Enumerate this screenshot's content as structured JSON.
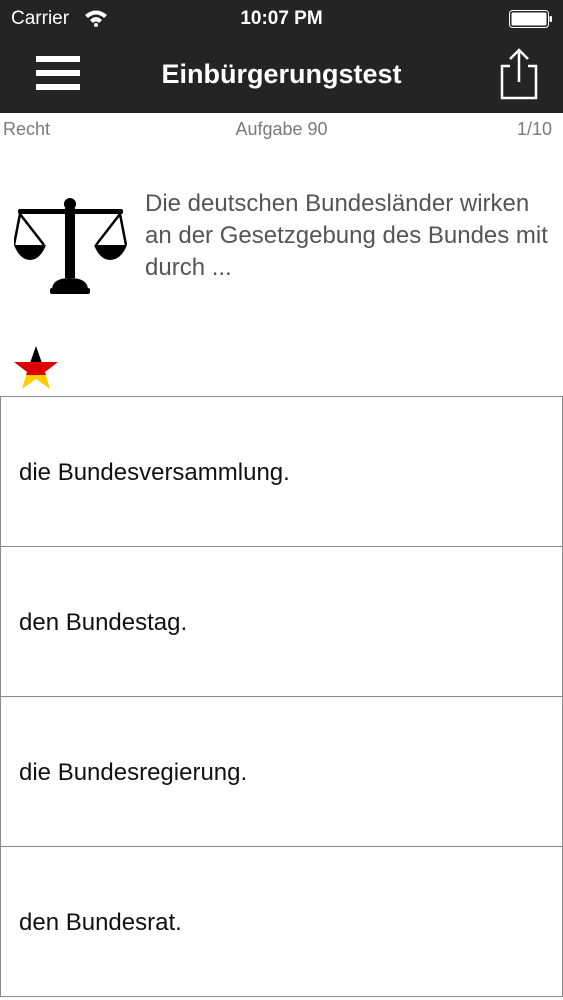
{
  "status_bar": {
    "carrier": "Carrier",
    "time": "10:07 PM"
  },
  "nav_bar": {
    "title": "Einbürgerungstest",
    "left_icon": "menu-icon",
    "right_icon": "share-icon",
    "background": "#242424"
  },
  "info_row": {
    "category": "Recht",
    "task": "Aufgabe 90",
    "progress": "1/10"
  },
  "question": {
    "icon": "law-scales-icon",
    "text": "Die deutschen Bundesländer wirken an der Gesetzgebung des Bundes mit durch ..."
  },
  "favorite": {
    "icon": "star-flag-icon",
    "colors": [
      "#000000",
      "#dd0000",
      "#ffce00"
    ]
  },
  "answers": [
    {
      "text": "die Bundesversammlung."
    },
    {
      "text": "den Bundestag."
    },
    {
      "text": "die Bundesregierung."
    },
    {
      "text": "den Bundesrat."
    }
  ]
}
